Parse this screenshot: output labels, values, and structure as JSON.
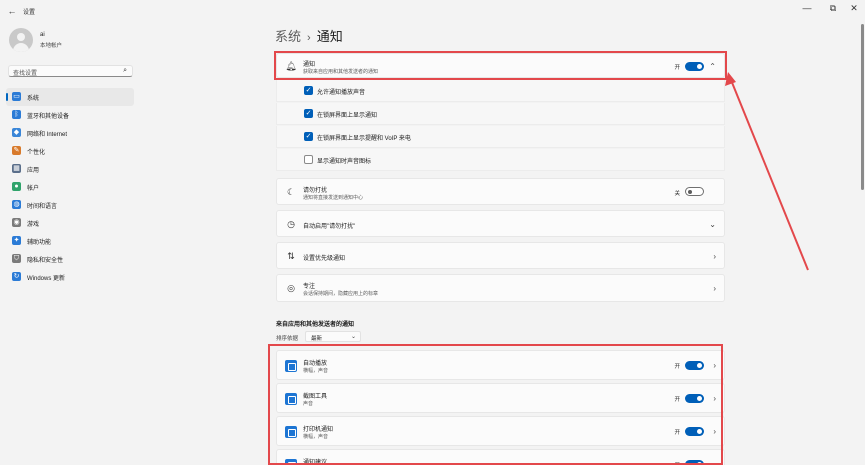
{
  "window": {
    "back_icon": "back-arrow-icon",
    "app_title": "设置",
    "minimize_glyph": "—",
    "maximize_glyph": "⧉",
    "close_glyph": "✕"
  },
  "user": {
    "name": "ai",
    "account_type": "本地帐户"
  },
  "search": {
    "placeholder": "查找设置",
    "icon_glyph": "⌕"
  },
  "nav": {
    "items": [
      {
        "label": "系统",
        "icon": "system-icon",
        "glyph": "▭",
        "color": "#2b7bd6"
      },
      {
        "label": "蓝牙和其他设备",
        "icon": "bluetooth-icon",
        "glyph": "ᛒ",
        "color": "#2b7bd6"
      },
      {
        "label": "网络和 Internet",
        "icon": "wifi-icon",
        "glyph": "◆",
        "color": "#3a86d8"
      },
      {
        "label": "个性化",
        "icon": "brush-icon",
        "glyph": "✎",
        "color": "#d87a2b"
      },
      {
        "label": "应用",
        "icon": "apps-icon",
        "glyph": "▦",
        "color": "#5a6e8a"
      },
      {
        "label": "帐户",
        "icon": "account-icon",
        "glyph": "●",
        "color": "#2fa36b"
      },
      {
        "label": "时间和语言",
        "icon": "globe-icon",
        "glyph": "◍",
        "color": "#2b7bd6"
      },
      {
        "label": "游戏",
        "icon": "gamepad-icon",
        "glyph": "◉",
        "color": "#7a7a7a"
      },
      {
        "label": "辅助功能",
        "icon": "accessibility-icon",
        "glyph": "✦",
        "color": "#2b7bd6"
      },
      {
        "label": "隐私和安全性",
        "icon": "shield-icon",
        "glyph": "⛉",
        "color": "#7a7a7a"
      },
      {
        "label": "Windows 更新",
        "icon": "update-icon",
        "glyph": "↻",
        "color": "#2b7bd6"
      }
    ]
  },
  "breadcrumb": {
    "parent": "系统",
    "separator": "›",
    "current": "通知"
  },
  "notifications": {
    "title": "通知",
    "subtitle": "获取来自应用和其他发送者的通知",
    "state": "开",
    "icon": "bell-icon",
    "chevron": "⌃",
    "options": [
      {
        "label": "允许通知播放声音",
        "checked": true,
        "mark": "✓"
      },
      {
        "label": "在锁屏界面上显示通知",
        "checked": true,
        "mark": "✓"
      },
      {
        "label": "在锁屏界面上显示提醒和 VoIP 来电",
        "checked": true,
        "mark": "✓"
      },
      {
        "label": "显示通知时声音图标",
        "checked": false,
        "mark": ""
      }
    ]
  },
  "dnd": {
    "title": "请勿打扰",
    "subtitle": "通知将直接发送到通知中心",
    "state": "关",
    "icon": "moon-bell-icon"
  },
  "auto_dnd": {
    "title": "自动启用\"请勿打扰\"",
    "icon": "clock-icon",
    "chevron": "⌄"
  },
  "priority": {
    "title": "设置优先级通知",
    "icon": "priority-icon",
    "chevron": "›"
  },
  "focus": {
    "title": "专注",
    "subtitle": "会话保持期间，隐藏应用上的标章",
    "icon": "focus-icon",
    "chevron": "›"
  },
  "apps_section": {
    "title": "来自应用和其他发送者的通知",
    "sort_label": "排序依据",
    "sort_value": "最新",
    "sort_caret": "⌄",
    "apps": [
      {
        "title": "自动播放",
        "subtitle": "横幅，声音",
        "state": "开",
        "icon": "autoplay-icon"
      },
      {
        "title": "截图工具",
        "subtitle": "声音",
        "state": "开",
        "icon": "snipping-tool-icon"
      },
      {
        "title": "打印机通知",
        "subtitle": "横幅，声音",
        "state": "开",
        "icon": "printer-icon"
      },
      {
        "title": "通知建议",
        "subtitle": "",
        "state": "开",
        "icon": "suggestion-icon"
      }
    ],
    "chevron": "›"
  },
  "colors": {
    "accent": "#005fb8",
    "highlight": "#e3484b"
  }
}
